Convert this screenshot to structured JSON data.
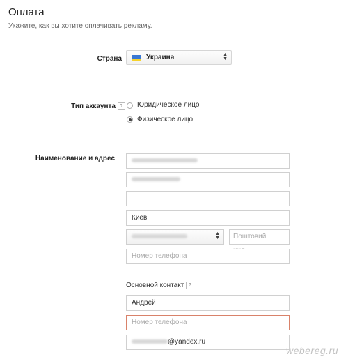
{
  "page": {
    "title": "Оплата",
    "subtitle": "Укажите, как вы хотите оплачивать рекламу."
  },
  "country": {
    "label": "Страна",
    "value": "Украина",
    "flag_colors": [
      "#3a78d4",
      "#f6d22b"
    ]
  },
  "account_type": {
    "label": "Тип аккаунта",
    "help": "?",
    "options": [
      {
        "label": "Юридическое лицо",
        "selected": false
      },
      {
        "label": "Физическое лицо",
        "selected": true
      }
    ]
  },
  "name_address": {
    "label": "Наименование и адрес",
    "city": "Киев",
    "postal_placeholder": "Поштовий инд...",
    "phone_placeholder": "Номер телефона"
  },
  "contact": {
    "label": "Основной контакт",
    "help": "?",
    "name": "Андрей",
    "phone_placeholder": "Номер телефона",
    "email_suffix": "@yandex.ru"
  },
  "watermark": "webereg.ru",
  "colors": {
    "error_border": "#d9826a",
    "flag_blue": "#3a78d4",
    "flag_yellow": "#f6d22b"
  }
}
